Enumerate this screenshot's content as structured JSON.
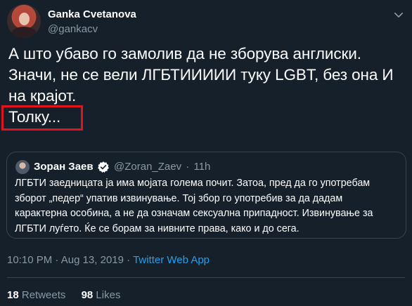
{
  "author": {
    "display_name": "Ganka Cvetanova",
    "handle": "@gankacv"
  },
  "tweet": {
    "lines": [
      "А што убаво го замолив да не зборува англиски.",
      "Значи, не се вели ЛГБТИИИИИ туку LGBT, без она И",
      "на крајот.",
      "Толку..."
    ],
    "highlight_color": "#e0141e"
  },
  "quoted": {
    "display_name": "Зоран Заев",
    "handle": "@Zoran_Zaev",
    "separator": "·",
    "time": "11h",
    "lines": [
      "ЛГБТИ заедницата ја има мојата голема почит. Затоа, пред да го употребам",
      "зборот „педер“ упатив извинување. Тој збор го употребив за да дадам",
      "карактерна особина, а не да означам сексуална припадност. Извинување за",
      "ЛГБТИ луѓето. Ќе се борам за нивните права, како и до сега."
    ]
  },
  "meta": {
    "time": "10:10 PM",
    "separator": "·",
    "date": "Aug 13, 2019",
    "source": "Twitter Web App"
  },
  "stats": {
    "retweets_count": "18",
    "retweets_label": "Retweets",
    "likes_count": "98",
    "likes_label": "Likes"
  },
  "colors": {
    "background": "#15202b",
    "text": "#ffffff",
    "secondary": "#8899a6",
    "accent": "#1da1f2",
    "border": "#38444d"
  },
  "icons": [
    "chevron-down-icon",
    "verified-badge-icon"
  ]
}
